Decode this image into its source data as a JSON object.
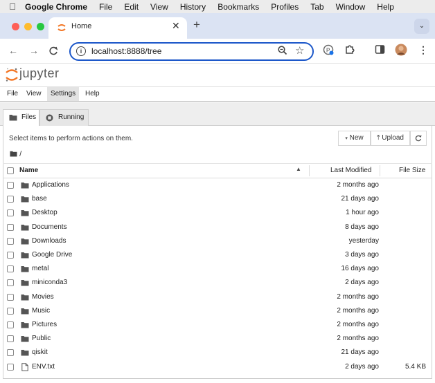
{
  "menubar": {
    "app": "Google Chrome",
    "items": [
      "File",
      "Edit",
      "View",
      "History",
      "Bookmarks",
      "Profiles",
      "Tab",
      "Window",
      "Help"
    ]
  },
  "browser": {
    "tab_title": "Home",
    "url": "localhost:8888/tree"
  },
  "jupyter": {
    "logo_text": "jupyter",
    "menu": [
      "File",
      "View",
      "Settings",
      "Help"
    ],
    "active_menu": "Settings",
    "tabs": [
      "Files",
      "Running"
    ],
    "instructions": "Select items to perform actions on them.",
    "new_label": "New",
    "upload_label": "Upload",
    "breadcrumb": "/",
    "columns": {
      "name": "Name",
      "modified": "Last Modified",
      "size": "File Size"
    },
    "rows": [
      {
        "name": "Applications",
        "modified": "2 months ago",
        "size": "",
        "type": "folder"
      },
      {
        "name": "base",
        "modified": "21 days ago",
        "size": "",
        "type": "folder"
      },
      {
        "name": "Desktop",
        "modified": "1 hour ago",
        "size": "",
        "type": "folder"
      },
      {
        "name": "Documents",
        "modified": "8 days ago",
        "size": "",
        "type": "folder"
      },
      {
        "name": "Downloads",
        "modified": "yesterday",
        "size": "",
        "type": "folder"
      },
      {
        "name": "Google Drive",
        "modified": "3 days ago",
        "size": "",
        "type": "folder"
      },
      {
        "name": "metal",
        "modified": "16 days ago",
        "size": "",
        "type": "folder"
      },
      {
        "name": "miniconda3",
        "modified": "2 days ago",
        "size": "",
        "type": "folder"
      },
      {
        "name": "Movies",
        "modified": "2 months ago",
        "size": "",
        "type": "folder"
      },
      {
        "name": "Music",
        "modified": "2 months ago",
        "size": "",
        "type": "folder"
      },
      {
        "name": "Pictures",
        "modified": "2 months ago",
        "size": "",
        "type": "folder"
      },
      {
        "name": "Public",
        "modified": "2 months ago",
        "size": "",
        "type": "folder"
      },
      {
        "name": "qiskit",
        "modified": "21 days ago",
        "size": "",
        "type": "folder"
      },
      {
        "name": "ENV.txt",
        "modified": "2 days ago",
        "size": "5.4 KB",
        "type": "file"
      }
    ]
  },
  "colors": {
    "jupyter_orange": "#f37726",
    "omnibox_focus": "#1a56c9",
    "tabstrip_bg": "#dbe3f3"
  }
}
